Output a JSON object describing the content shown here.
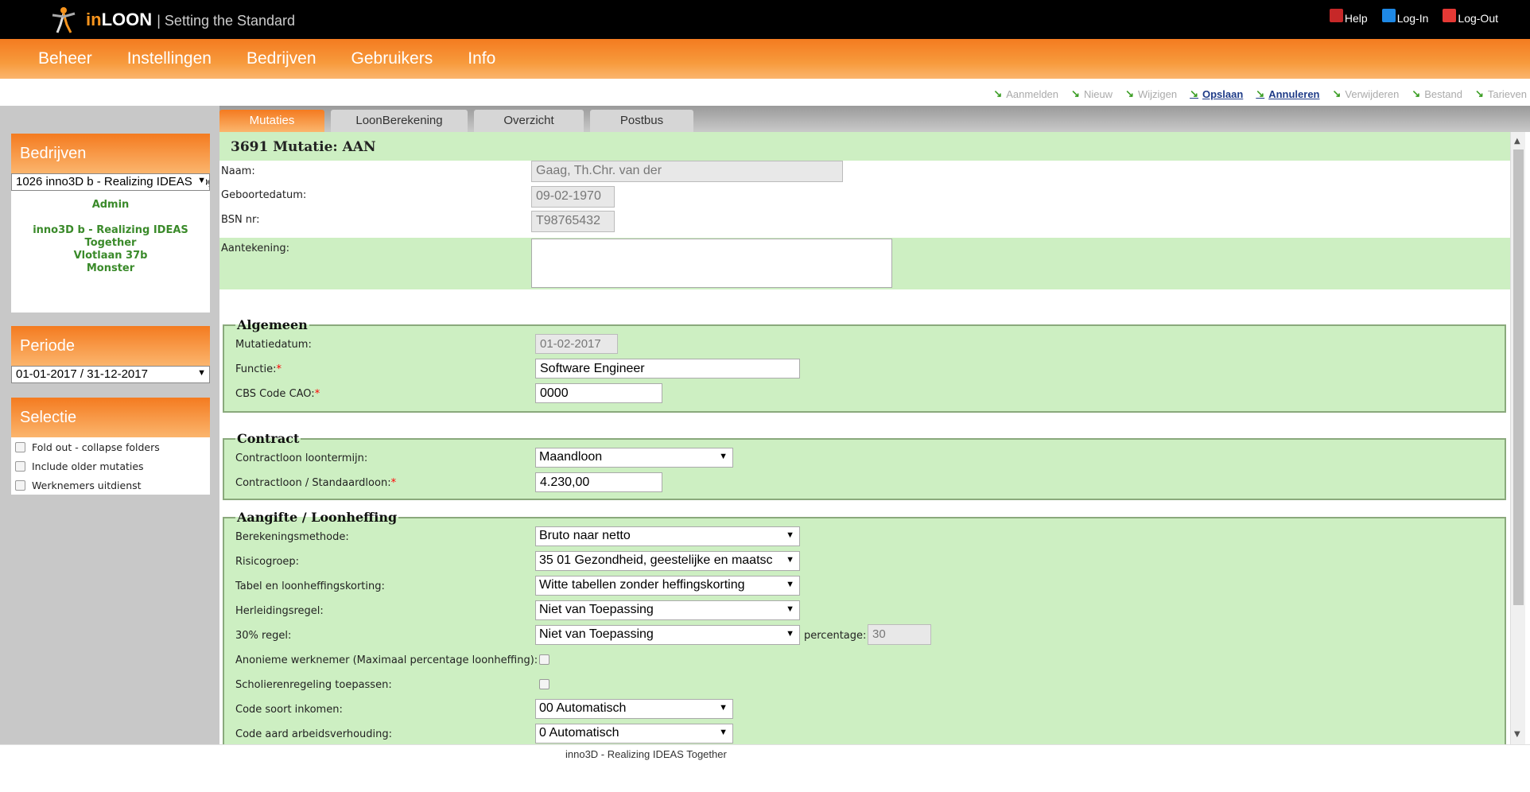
{
  "app": {
    "brand_in": "in",
    "brand_loon": "LOON",
    "brand_tagline": "| Setting the Standard"
  },
  "toplinks": [
    {
      "label": "Help",
      "icon": "help-icon"
    },
    {
      "label": "Log-In",
      "icon": "login-icon"
    },
    {
      "label": "Log-Out",
      "icon": "logout-icon"
    }
  ],
  "menu": [
    "Beheer",
    "Instellingen",
    "Bedrijven",
    "Gebruikers",
    "Info"
  ],
  "actions": [
    {
      "label": "Aanmelden",
      "active": false
    },
    {
      "label": "Nieuw",
      "active": false
    },
    {
      "label": "Wijzigen",
      "active": false
    },
    {
      "label": "Opslaan",
      "active": true
    },
    {
      "label": "Annuleren",
      "active": true
    },
    {
      "label": "Verwijderen",
      "active": false
    },
    {
      "label": "Bestand",
      "active": false
    },
    {
      "label": "Tarieven",
      "active": false
    }
  ],
  "sidebar": {
    "bedrijven": {
      "title": "Bedrijven",
      "selected": "1026 inno3D b - Realizing IDEAS Together",
      "role": "Admin",
      "company_line1": "inno3D b - Realizing IDEAS",
      "company_line2": "Together",
      "street": "Vlotlaan 37b",
      "city": "Monster"
    },
    "periode": {
      "title": "Periode",
      "selected": "01-01-2017 / 31-12-2017"
    },
    "selectie": {
      "title": "Selectie",
      "options": [
        "Fold out - collapse folders",
        "Include older mutaties",
        "Werknemers uitdienst"
      ]
    }
  },
  "tabs": [
    "Mutaties",
    "LoonBerekening",
    "Overzicht",
    "Postbus"
  ],
  "form": {
    "title": "3691 Mutatie: AAN",
    "naam_label": "Naam:",
    "naam_value": "Gaag, Th.Chr. van der",
    "geboortedatum_label": "Geboortedatum:",
    "geboortedatum_value": "09-02-1970",
    "bsn_label": "BSN nr:",
    "bsn_value": "T98765432",
    "aantekening_label": "Aantekening:",
    "aantekening_value": ""
  },
  "algemeen": {
    "legend": "Algemeen",
    "mutatiedatum_label": "Mutatiedatum:",
    "mutatiedatum_value": "01-02-2017",
    "functie_label": "Functie:",
    "functie_value": "Software Engineer",
    "cbs_label": "CBS Code CAO:",
    "cbs_value": "0000"
  },
  "contract": {
    "legend": "Contract",
    "loontermijn_label": "Contractloon loontermijn:",
    "loontermijn_value": "Maandloon",
    "standaardloon_label": "Contractloon / Standaardloon:",
    "standaardloon_value": "4.230,00"
  },
  "aangifte": {
    "legend": "Aangifte / Loonheffing",
    "rows": [
      {
        "label": "Berekeningsmethode:",
        "value": "Bruto naar netto"
      },
      {
        "label": "Risicogroep:",
        "value": "35 01 Gezondheid, geestelijke en maatsc"
      },
      {
        "label": "Tabel en loonheffingskorting:",
        "value": "Witte tabellen zonder heffingskorting"
      },
      {
        "label": "Herleidingsregel:",
        "value": "Niet van Toepassing"
      },
      {
        "label": "30% regel:",
        "value": "Niet van Toepassing"
      }
    ],
    "percentage_label": "percentage:",
    "percentage_value": "30",
    "anoniem_label": "Anonieme werknemer (Maximaal percentage loonheffing):",
    "scholieren_label": "Scholierenregeling toepassen:",
    "code_soort_label": "Code soort inkomen:",
    "code_soort_value": "00 Automatisch",
    "code_aard_label": "Code aard arbeidsverhouding:",
    "code_aard_value": "0 Automatisch"
  },
  "footer": "inno3D - Realizing IDEAS Together"
}
